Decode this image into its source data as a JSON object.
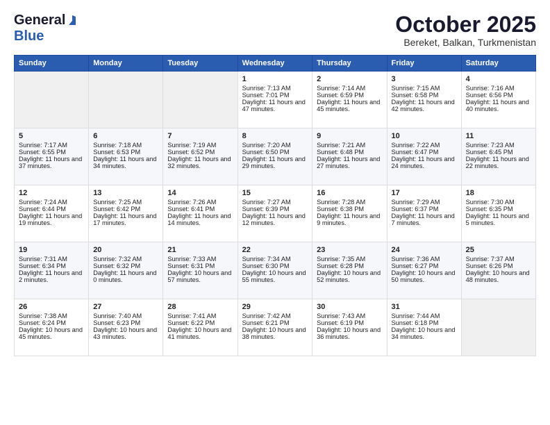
{
  "header": {
    "logo_general": "General",
    "logo_blue": "Blue",
    "month_title": "October 2025",
    "location": "Bereket, Balkan, Turkmenistan"
  },
  "weekdays": [
    "Sunday",
    "Monday",
    "Tuesday",
    "Wednesday",
    "Thursday",
    "Friday",
    "Saturday"
  ],
  "weeks": [
    [
      {
        "day": "",
        "data": ""
      },
      {
        "day": "",
        "data": ""
      },
      {
        "day": "",
        "data": ""
      },
      {
        "day": "1",
        "data": "Sunrise: 7:13 AM\nSunset: 7:01 PM\nDaylight: 11 hours and 47 minutes."
      },
      {
        "day": "2",
        "data": "Sunrise: 7:14 AM\nSunset: 6:59 PM\nDaylight: 11 hours and 45 minutes."
      },
      {
        "day": "3",
        "data": "Sunrise: 7:15 AM\nSunset: 6:58 PM\nDaylight: 11 hours and 42 minutes."
      },
      {
        "day": "4",
        "data": "Sunrise: 7:16 AM\nSunset: 6:56 PM\nDaylight: 11 hours and 40 minutes."
      }
    ],
    [
      {
        "day": "5",
        "data": "Sunrise: 7:17 AM\nSunset: 6:55 PM\nDaylight: 11 hours and 37 minutes."
      },
      {
        "day": "6",
        "data": "Sunrise: 7:18 AM\nSunset: 6:53 PM\nDaylight: 11 hours and 34 minutes."
      },
      {
        "day": "7",
        "data": "Sunrise: 7:19 AM\nSunset: 6:52 PM\nDaylight: 11 hours and 32 minutes."
      },
      {
        "day": "8",
        "data": "Sunrise: 7:20 AM\nSunset: 6:50 PM\nDaylight: 11 hours and 29 minutes."
      },
      {
        "day": "9",
        "data": "Sunrise: 7:21 AM\nSunset: 6:48 PM\nDaylight: 11 hours and 27 minutes."
      },
      {
        "day": "10",
        "data": "Sunrise: 7:22 AM\nSunset: 6:47 PM\nDaylight: 11 hours and 24 minutes."
      },
      {
        "day": "11",
        "data": "Sunrise: 7:23 AM\nSunset: 6:45 PM\nDaylight: 11 hours and 22 minutes."
      }
    ],
    [
      {
        "day": "12",
        "data": "Sunrise: 7:24 AM\nSunset: 6:44 PM\nDaylight: 11 hours and 19 minutes."
      },
      {
        "day": "13",
        "data": "Sunrise: 7:25 AM\nSunset: 6:42 PM\nDaylight: 11 hours and 17 minutes."
      },
      {
        "day": "14",
        "data": "Sunrise: 7:26 AM\nSunset: 6:41 PM\nDaylight: 11 hours and 14 minutes."
      },
      {
        "day": "15",
        "data": "Sunrise: 7:27 AM\nSunset: 6:39 PM\nDaylight: 11 hours and 12 minutes."
      },
      {
        "day": "16",
        "data": "Sunrise: 7:28 AM\nSunset: 6:38 PM\nDaylight: 11 hours and 9 minutes."
      },
      {
        "day": "17",
        "data": "Sunrise: 7:29 AM\nSunset: 6:37 PM\nDaylight: 11 hours and 7 minutes."
      },
      {
        "day": "18",
        "data": "Sunrise: 7:30 AM\nSunset: 6:35 PM\nDaylight: 11 hours and 5 minutes."
      }
    ],
    [
      {
        "day": "19",
        "data": "Sunrise: 7:31 AM\nSunset: 6:34 PM\nDaylight: 11 hours and 2 minutes."
      },
      {
        "day": "20",
        "data": "Sunrise: 7:32 AM\nSunset: 6:32 PM\nDaylight: 11 hours and 0 minutes."
      },
      {
        "day": "21",
        "data": "Sunrise: 7:33 AM\nSunset: 6:31 PM\nDaylight: 10 hours and 57 minutes."
      },
      {
        "day": "22",
        "data": "Sunrise: 7:34 AM\nSunset: 6:30 PM\nDaylight: 10 hours and 55 minutes."
      },
      {
        "day": "23",
        "data": "Sunrise: 7:35 AM\nSunset: 6:28 PM\nDaylight: 10 hours and 52 minutes."
      },
      {
        "day": "24",
        "data": "Sunrise: 7:36 AM\nSunset: 6:27 PM\nDaylight: 10 hours and 50 minutes."
      },
      {
        "day": "25",
        "data": "Sunrise: 7:37 AM\nSunset: 6:26 PM\nDaylight: 10 hours and 48 minutes."
      }
    ],
    [
      {
        "day": "26",
        "data": "Sunrise: 7:38 AM\nSunset: 6:24 PM\nDaylight: 10 hours and 45 minutes."
      },
      {
        "day": "27",
        "data": "Sunrise: 7:40 AM\nSunset: 6:23 PM\nDaylight: 10 hours and 43 minutes."
      },
      {
        "day": "28",
        "data": "Sunrise: 7:41 AM\nSunset: 6:22 PM\nDaylight: 10 hours and 41 minutes."
      },
      {
        "day": "29",
        "data": "Sunrise: 7:42 AM\nSunset: 6:21 PM\nDaylight: 10 hours and 38 minutes."
      },
      {
        "day": "30",
        "data": "Sunrise: 7:43 AM\nSunset: 6:19 PM\nDaylight: 10 hours and 36 minutes."
      },
      {
        "day": "31",
        "data": "Sunrise: 7:44 AM\nSunset: 6:18 PM\nDaylight: 10 hours and 34 minutes."
      },
      {
        "day": "",
        "data": ""
      }
    ]
  ]
}
